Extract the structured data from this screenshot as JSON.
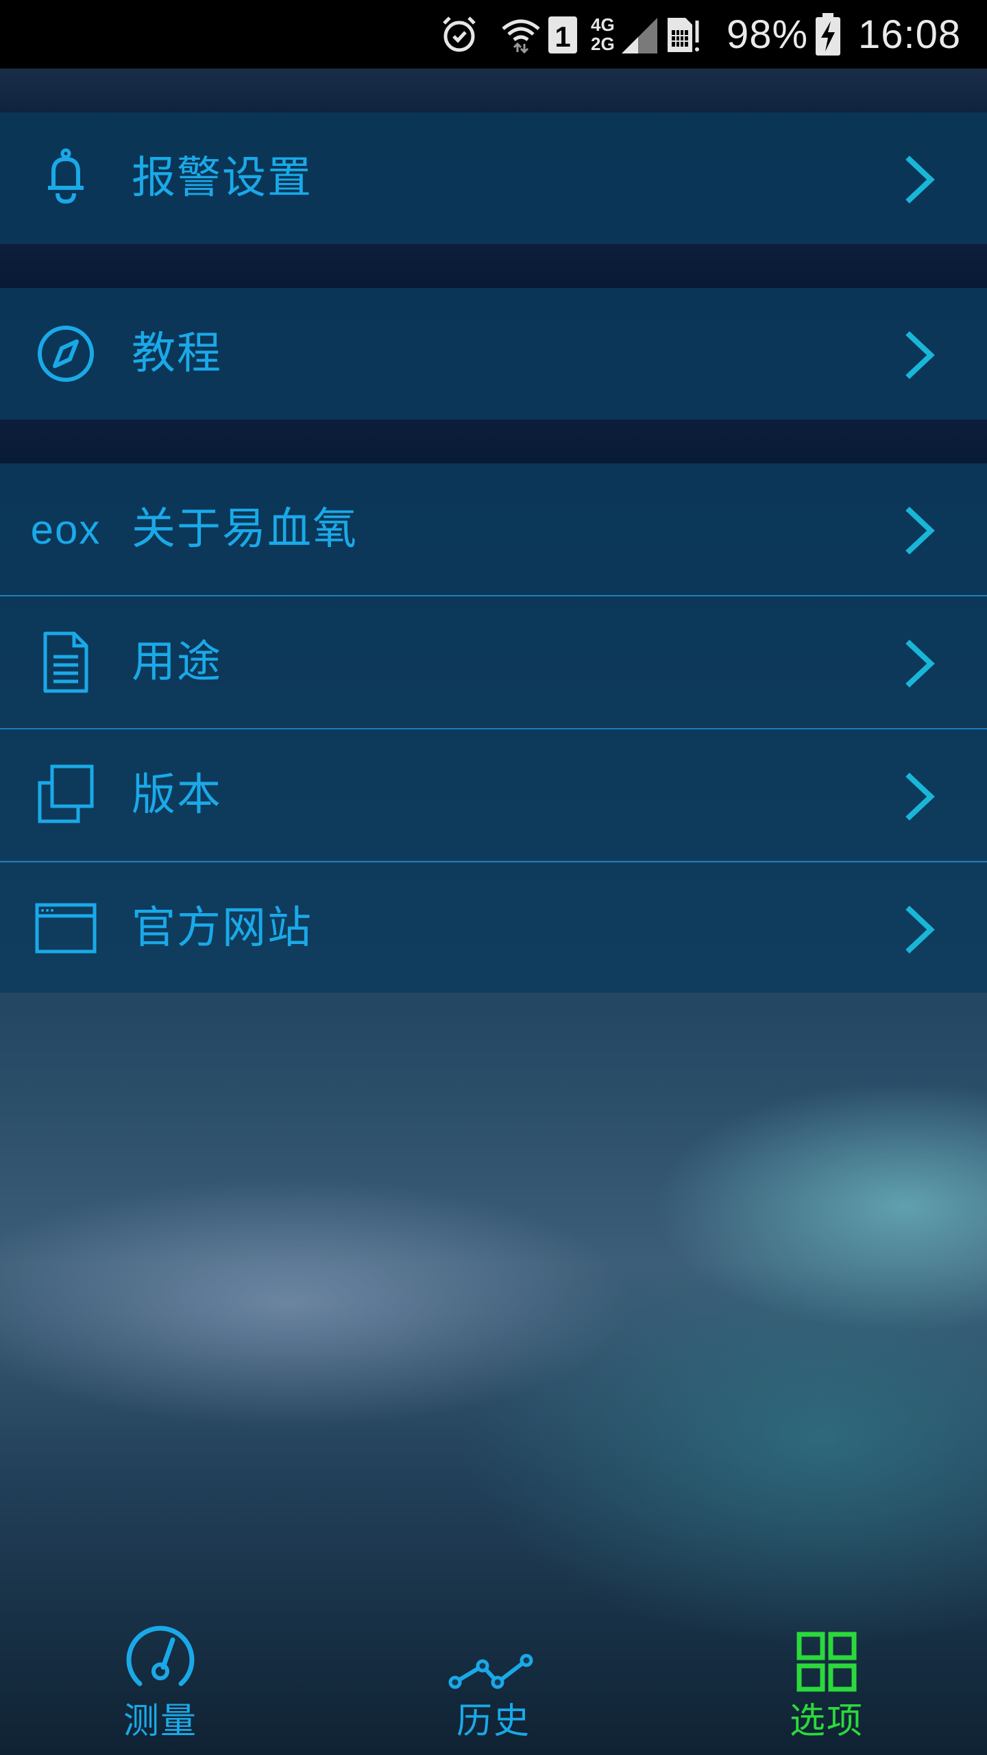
{
  "status_bar": {
    "battery_percent": "98%",
    "time": "16:08",
    "sim_slot": "1",
    "network_top": "4G",
    "network_bottom": "2G",
    "icons": [
      "alarm-icon",
      "wifi-icon",
      "sim-1-icon",
      "signal-icon",
      "sim-card-icon",
      "battery-charging-icon"
    ]
  },
  "menu": {
    "items": [
      {
        "label": "报警设置",
        "icon": "bell-icon"
      },
      {
        "label": "教程",
        "icon": "compass-icon"
      },
      {
        "label": "关于易血氧",
        "icon_text": "eox"
      },
      {
        "label": "用途",
        "icon": "document-icon"
      },
      {
        "label": "版本",
        "icon": "copy-icon"
      },
      {
        "label": "官方网站",
        "icon": "browser-window-icon"
      }
    ]
  },
  "bottom_nav": {
    "items": [
      {
        "label": "测量",
        "icon": "gauge-icon",
        "active": false
      },
      {
        "label": "历史",
        "icon": "line-graph-icon",
        "active": false
      },
      {
        "label": "选项",
        "icon": "grid-icon",
        "active": true
      }
    ]
  },
  "colors": {
    "accent": "#1aa9e8",
    "active": "#2bd93b",
    "chevron": "#19b6d8",
    "divider": "#1d7fbf"
  }
}
